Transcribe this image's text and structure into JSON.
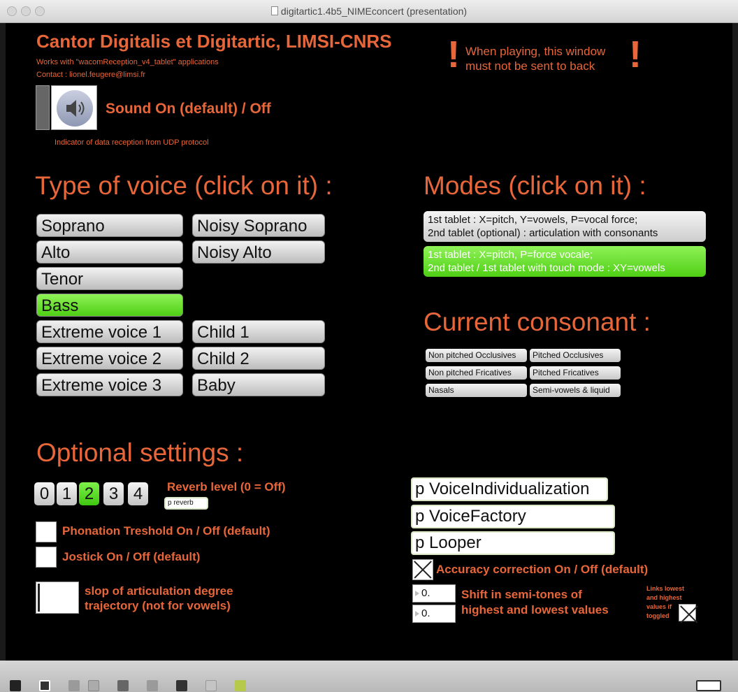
{
  "window": {
    "title": "digitartic1.4b5_NIMEconcert (presentation)"
  },
  "header": {
    "title": "Cantor Digitalis et Digitartic, LIMSI-CNRS",
    "works_with": "Works with \"wacomReception_v4_tablet\" applications",
    "contact": "Contact : lionel.feugere@limsi.fr",
    "warning_line1": "When playing, this window",
    "warning_line2": "must not be sent to back",
    "sound_label": "Sound On (default) / Off",
    "udp_indicator": "Indicator of data reception from UDP protocol"
  },
  "voice": {
    "title": "Type of voice (click on it) :",
    "left": [
      "Soprano",
      "Alto",
      "Tenor",
      "Bass",
      "Extreme voice 1",
      "Extreme voice 2",
      "Extreme voice 3"
    ],
    "right": [
      "Noisy Soprano",
      "Noisy Alto",
      "Child 1",
      "Child 2",
      "Baby"
    ],
    "selected": "Bass"
  },
  "modes": {
    "title": "Modes (click on it) :",
    "mode1_line1": "1st tablet : X=pitch, Y=vowels, P=vocal force;",
    "mode1_line2": "2nd tablet (optional) : articulation with consonants",
    "mode2_line1": "1st tablet : X=pitch, P=force vocale;",
    "mode2_line2": "2nd tablet / 1st tablet with touch mode : XY=vowels"
  },
  "consonant": {
    "title": "Current consonant :",
    "items": [
      "Non pitched Occlusives",
      "Pitched Occlusives",
      "Non pitched Fricatives",
      "Pitched Fricatives",
      "Nasals",
      "Semi-vowels & liquid"
    ]
  },
  "optional": {
    "title": "Optional settings :",
    "reverb_levels": [
      "0",
      "1",
      "2",
      "3",
      "4"
    ],
    "reverb_selected": "2",
    "reverb_label": "Reverb level (0 = Off)",
    "reverb_object": "p reverb",
    "phonation": "Phonation Treshold On / Off (default)",
    "joystick": "Jostick On / Off (default)",
    "slop_line1": "slop of articulation degree",
    "slop_line2": "trajectory (not for vowels)"
  },
  "right_settings": {
    "voice_indiv": "p VoiceIndividualization",
    "voice_factory": "p VoiceFactory",
    "looper": "p Looper",
    "accuracy": "Accuracy correction On / Off (default)",
    "shift_value1": "0.",
    "shift_value2": "0.",
    "shift_line1": "Shift in semi-tones of",
    "shift_line2": "highest and lowest values",
    "links_line1": "Links lowest",
    "links_line2": "and highest",
    "links_line3": "values if",
    "links_line4": "toggled"
  },
  "colors": {
    "accent": "#e7663a",
    "selected_green": "#5bd420",
    "background": "#000000"
  },
  "icons": [
    "lock-icon",
    "copy-icon",
    "mixer-icon",
    "close-box-icon",
    "patcher-icon",
    "info-icon",
    "toggle-icon",
    "grid-icon",
    "gear-icon",
    "split-view-icon"
  ]
}
